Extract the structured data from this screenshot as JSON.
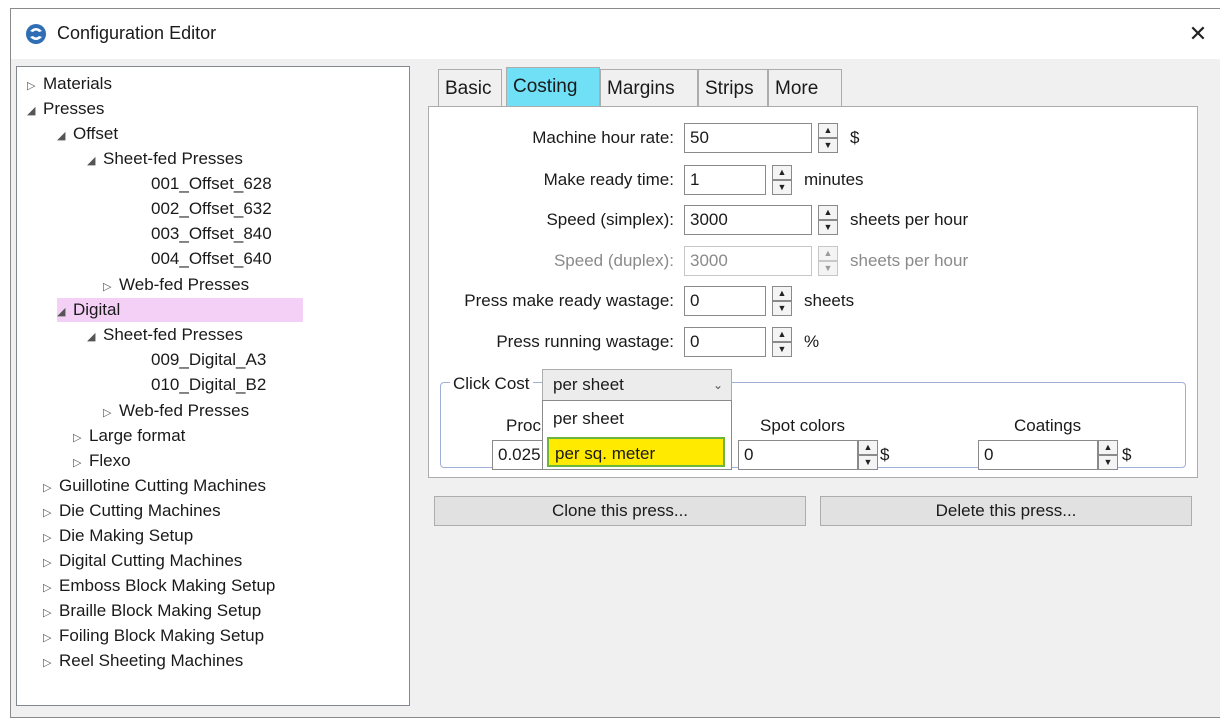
{
  "window": {
    "title": "Configuration Editor",
    "close_glyph": "✕"
  },
  "tree": {
    "materials": "Materials",
    "presses": "Presses",
    "offset": "Offset",
    "offset_sheetfed": "Sheet-fed Presses",
    "o1": "001_Offset_628",
    "o2": "002_Offset_632",
    "o3": "003_Offset_840",
    "o4": "004_Offset_640",
    "offset_webfed": "Web-fed Presses",
    "digital": "Digital",
    "digital_sheetfed": "Sheet-fed Presses",
    "d1": "009_Digital_A3",
    "d2": "010_Digital_B2",
    "digital_webfed": "Web-fed Presses",
    "large_format": "Large format",
    "flexo": "Flexo",
    "guillotine": "Guillotine Cutting Machines",
    "die_cutting": "Die Cutting Machines",
    "die_making": "Die Making Setup",
    "digital_cutting": "Digital Cutting Machines",
    "emboss": "Emboss Block Making Setup",
    "braille": "Braille Block Making Setup",
    "foiling": "Foiling Block Making Setup",
    "reel": "Reel Sheeting Machines"
  },
  "tabs": {
    "basic": "Basic",
    "costing": "Costing",
    "margins": "Margins",
    "strips": "Strips",
    "more": "More"
  },
  "form": {
    "machine_hour_rate": {
      "label": "Machine hour rate:",
      "value": "50",
      "unit": "$"
    },
    "make_ready_time": {
      "label": "Make ready time:",
      "value": "1",
      "unit": "minutes"
    },
    "speed_simplex": {
      "label": "Speed (simplex):",
      "value": "3000",
      "unit": "sheets per hour"
    },
    "speed_duplex": {
      "label": "Speed (duplex):",
      "value": "3000",
      "unit": "sheets per hour"
    },
    "make_ready_wastage": {
      "label": "Press make ready wastage:",
      "value": "0",
      "unit": "sheets"
    },
    "running_wastage": {
      "label": "Press running wastage:",
      "value": "0",
      "unit": "%"
    }
  },
  "click_cost": {
    "title": "Click Cost",
    "selected": "per sheet",
    "options": [
      "per sheet",
      "per sq. meter"
    ],
    "process_label": "Proc",
    "process_value": "0.025",
    "spot_label": "Spot colors",
    "spot_value": "0",
    "spot_unit": "$",
    "coatings_label": "Coatings",
    "coatings_value": "0",
    "coatings_unit": "$"
  },
  "buttons": {
    "clone": "Clone this press...",
    "delete": "Delete this press..."
  },
  "colors": {
    "active_tab": "#6fe0f5",
    "tree_highlight": "#f4d0f7",
    "dropdown_selected": "#ffea00",
    "dropdown_selected_border": "#6db33f"
  }
}
